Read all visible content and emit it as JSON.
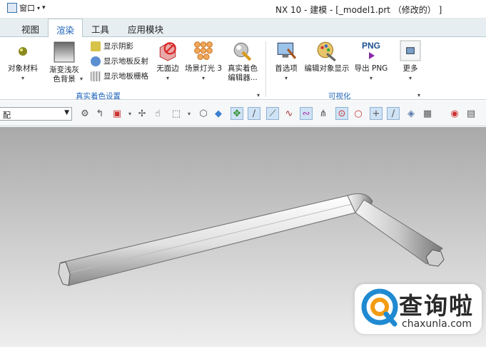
{
  "window": {
    "qa_menu_label": "窗口",
    "title": "NX 10 - 建模 - [_model1.prt （修改的） ]"
  },
  "tabs": [
    {
      "label": "视图",
      "active": false
    },
    {
      "label": "渲染",
      "active": true
    },
    {
      "label": "工具",
      "active": false
    },
    {
      "label": "应用模块",
      "active": false
    }
  ],
  "ribbon": {
    "groups": {
      "shading": {
        "label": "真实着色设置",
        "object_material": "对象材料",
        "gradient_bg_line1": "渐变浅灰",
        "gradient_bg_line2": "色背景",
        "show_shadow": "显示阴影",
        "show_floor_reflection": "显示地板反射",
        "show_floor_grid": "显示地板栅格",
        "no_face_edges": "无面边",
        "scene_lights": "场景灯光 3",
        "shading_editor_line1": "真实着色",
        "shading_editor_line2": "编辑器..."
      },
      "visualization": {
        "label": "可视化",
        "preferences": "首选项",
        "edit_object_display": "编辑对象显示",
        "export_png": "导出 PNG",
        "png_icon_text": "PNG",
        "more": "更多"
      }
    }
  },
  "toolbar": {
    "filter_value": "配"
  },
  "watermark": {
    "title": "查询啦",
    "subtitle": "chaxunla.com"
  }
}
